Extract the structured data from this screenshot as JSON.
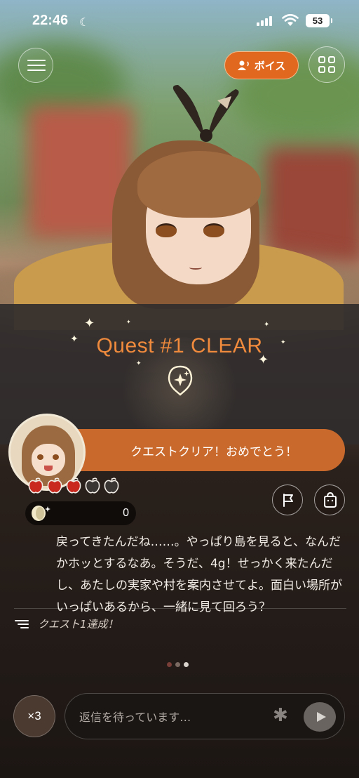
{
  "status_bar": {
    "time": "22:46",
    "battery": "53"
  },
  "top_controls": {
    "voice_label": "ボイス"
  },
  "quest": {
    "title": "Quest #1 CLEAR"
  },
  "message": {
    "banner_text": "クエストクリア！おめでとう！"
  },
  "stats": {
    "apples_filled": 3,
    "apples_total": 5,
    "coin_value": "0"
  },
  "dialogue": {
    "text": "戻ってきたんだね……。やっぱり島を見ると、なんだかホッとするなあ。そうだ、4g！せっかく来たんだし、あたしの実家や村を案内させてよ。面白い場所がいっぱいあるから、一緒に見て回ろう？"
  },
  "quest_log": {
    "text": "クエスト1達成！"
  },
  "pager": {
    "count": 3,
    "active_index": 2
  },
  "input_bar": {
    "speed_label": "×3",
    "placeholder": "返信を待っています…"
  },
  "colors": {
    "accent_orange": "#e0681f",
    "quest_title": "#f08a3c",
    "banner": "#c96a2c",
    "apple_red": "#c8281e",
    "apple_empty": "#3a3634"
  },
  "icons": {
    "menu": "menu-icon",
    "voice": "voice-icon",
    "grid": "grid-icon",
    "quest": "quest-sparkle-icon",
    "flag": "flag-icon",
    "bag": "bag-icon",
    "coin": "coin-icon",
    "quest_log": "list-icon",
    "send": "play-icon"
  }
}
